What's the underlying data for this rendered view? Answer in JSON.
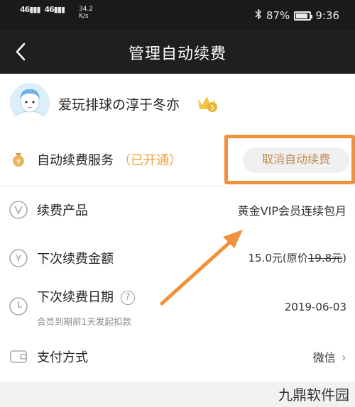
{
  "status_bar": {
    "signal_1": "46",
    "signal_2": "46",
    "speed_value": "34.2",
    "speed_unit": "K/s",
    "bluetooth_icon": "bluetooth-icon",
    "battery": "87%",
    "battery_level": 0.87,
    "time": "9:36"
  },
  "nav": {
    "back_icon": "chevron-left-icon",
    "title": "管理自动续费"
  },
  "user": {
    "name": "爱玩排球の淳于冬亦",
    "vip_badge_level": "5",
    "avatar_icon": "avatar-icon",
    "crown_icon": "vip-crown-icon"
  },
  "service": {
    "icon": "money-bag-icon",
    "label": "自动续费服务",
    "status": "（已开通）",
    "cancel_label": "取消自动续费"
  },
  "rows": {
    "product": {
      "icon": "v-circle-icon",
      "label": "续费产品",
      "value": "黄金VIP会员连续包月"
    },
    "amount": {
      "icon": "yen-circle-icon",
      "label": "下次续费金额",
      "value_now": "15.0元",
      "value_old_prefix": "(原价",
      "value_old": "19.8元",
      "value_old_suffix": ")"
    },
    "date": {
      "icon": "clock-icon",
      "label": "下次续费日期",
      "help": "?",
      "note": "会员到期前1天发起扣款",
      "value": "2019-06-03"
    },
    "payment": {
      "icon": "wallet-icon",
      "label": "支付方式",
      "value": "微信"
    }
  },
  "watermark": "九鼎软件园",
  "colors": {
    "accent_orange": "#f0913b",
    "status_orange": "#f3a13a",
    "cancel_text": "#c08a56",
    "nav_bg": "#1f1f1f"
  }
}
